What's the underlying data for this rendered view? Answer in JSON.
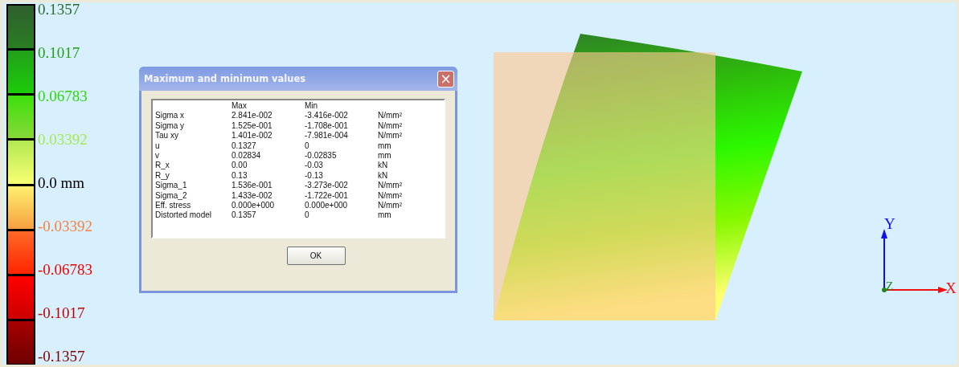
{
  "legend": {
    "labels": [
      {
        "text": "0.1357",
        "color": "#2e6b2e"
      },
      {
        "text": "0.1017",
        "color": "#22a01a"
      },
      {
        "text": "0.06783",
        "color": "#2ed80c"
      },
      {
        "text": "0.03392",
        "color": "#a8e850"
      },
      {
        "text": "0.0 mm",
        "color": "#000000"
      },
      {
        "text": "-0.03392",
        "color": "#f88040"
      },
      {
        "text": "-0.06783",
        "color": "#ee0000"
      },
      {
        "text": "-0.1017",
        "color": "#c00000"
      },
      {
        "text": "-0.1357",
        "color": "#800000"
      }
    ]
  },
  "dialog": {
    "title": "Maximum and minimum values",
    "close": "×",
    "columns": [
      "Max",
      "Min"
    ],
    "rows": [
      {
        "name": "Sigma x",
        "max": "2.841e-002",
        "min": "-3.416e-002",
        "unit": "N/mm²"
      },
      {
        "name": "Sigma y",
        "max": "1.525e-001",
        "min": "-1.708e-001",
        "unit": "N/mm²"
      },
      {
        "name": "Tau xy",
        "max": "1.401e-002",
        "min": "-7.981e-004",
        "unit": "N/mm²"
      },
      {
        "name": "u",
        "max": "0.1327",
        "min": "0",
        "unit": "mm"
      },
      {
        "name": "v",
        "max": "0.02834",
        "min": "-0.02835",
        "unit": "mm"
      },
      {
        "name": "R_x",
        "max": "0.00",
        "min": "-0.03",
        "unit": "kN"
      },
      {
        "name": "R_y",
        "max": "0.13",
        "min": "-0.13",
        "unit": "kN"
      },
      {
        "name": "Sigma_1",
        "max": "1.536e-001",
        "min": "-3.273e-002",
        "unit": "N/mm²"
      },
      {
        "name": "Sigma_2",
        "max": "1.433e-002",
        "min": "-1.722e-001",
        "unit": "N/mm²"
      },
      {
        "name": "Eff. stress",
        "max": "0.000e+000",
        "min": "0.000e+000",
        "unit": "N/mm²"
      },
      {
        "name": "Distorted model",
        "max": "0.1357",
        "min": "0",
        "unit": "mm"
      }
    ],
    "ok_button": "OK"
  },
  "axes": {
    "y": "Y",
    "x": "X",
    "z": "Z"
  }
}
